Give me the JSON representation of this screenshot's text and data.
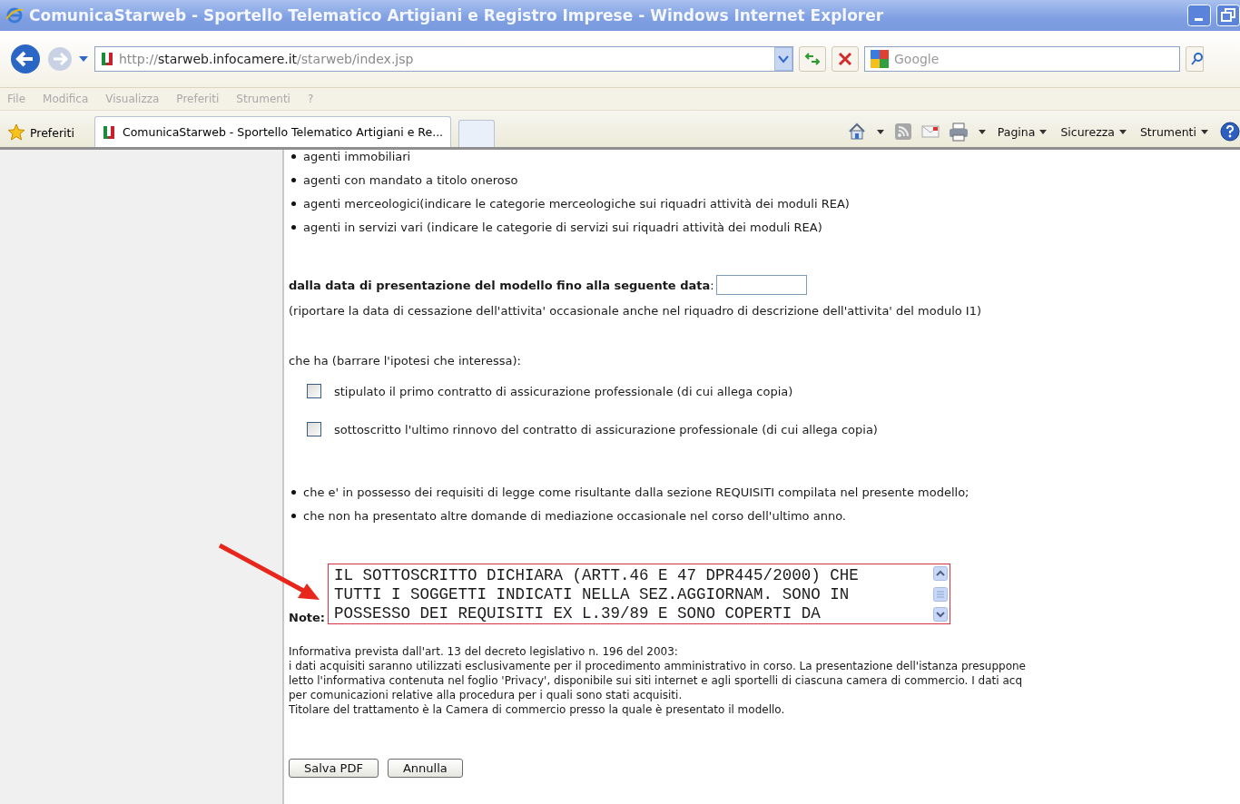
{
  "window": {
    "title": "ComunicaStarweb - Sportello Telematico Artigiani e Registro Imprese - Windows Internet Explorer"
  },
  "address_bar": {
    "scheme": "http://",
    "host": "starweb.infocamere.it",
    "path": "/starweb/index.jsp"
  },
  "search": {
    "placeholder": "Google"
  },
  "menu": [
    "File",
    "Modifica",
    "Visualizza",
    "Preferiti",
    "Strumenti",
    "?"
  ],
  "favorites_button": "Preferiti",
  "tabs": [
    {
      "label": "ComunicaStarweb - Sportello Telematico Artigiani e Re...",
      "selected": true
    }
  ],
  "command_bar": [
    "Pagina",
    "Sicurezza",
    "Strumenti"
  ],
  "agent_list": [
    "agenti immobiliari",
    "agenti con mandato a titolo oneroso",
    "agenti merceologici(indicare le categorie merceologiche sui riquadri attività dei moduli REA)",
    "agenti in servizi vari (indicare le categorie di servizi sui riquadri attività dei moduli REA)"
  ],
  "date_field": {
    "label": "**dalla data di presentazione del modello fino alla seguente data**:"
  },
  "date_note": "(riportare la data di cessazione dell'attivita' occasionale anche nel riquadro di descrizione dell'attivita' del modulo I1)",
  "insurance": {
    "prompt": "che ha (barrare l'ipotesi che interessa):",
    "options": [
      {
        "label": "stipulato il primo contratto di assicurazione professionale (di cui allega copia)",
        "checked": false
      },
      {
        "label": "sottoscritto l'ultimo rinnovo del contratto di assicurazione professionale (di cui allega copia)",
        "checked": false
      }
    ]
  },
  "declarations": [
    "che e' in possesso dei requisiti di legge come risultante dalla sezione REQUISITI compilata nel presente modello;",
    "che non ha presentato altre domande di mediazione occasionale nel corso dell'ultimo anno."
  ],
  "note": {
    "label": "Note:",
    "lines": [
      "IL SOTTOSCRITTO DICHIARA (ARTT.46 E 47 DPR445/2000) CHE",
      "TUTTI I SOGGETTI INDICATI NELLA SEZ.AGGIORNAM. SONO IN",
      "POSSESSO DEI REQUISITI EX L.39/89 E SONO COPERTI DA"
    ]
  },
  "privacy": [
    "Informativa prevista dall'art. 13 del decreto legislativo n. 196 del 2003:",
    "i dati acquisiti saranno utilizzati esclusivamente per il procedimento amministrativo in corso. La presentazione dell'istanza presuppone",
    "letto l'informativa contenuta nel foglio 'Privacy', disponibile sui siti internet e agli sportelli di ciascuna camera di commercio. I dati acq",
    "per comunicazioni relative alla procedura per i quali sono stati acquisiti.",
    "Titolare del trattamento è la Camera di commercio presso la quale è presentato il modello."
  ],
  "buttons": [
    "Salva PDF",
    "Annulla"
  ]
}
